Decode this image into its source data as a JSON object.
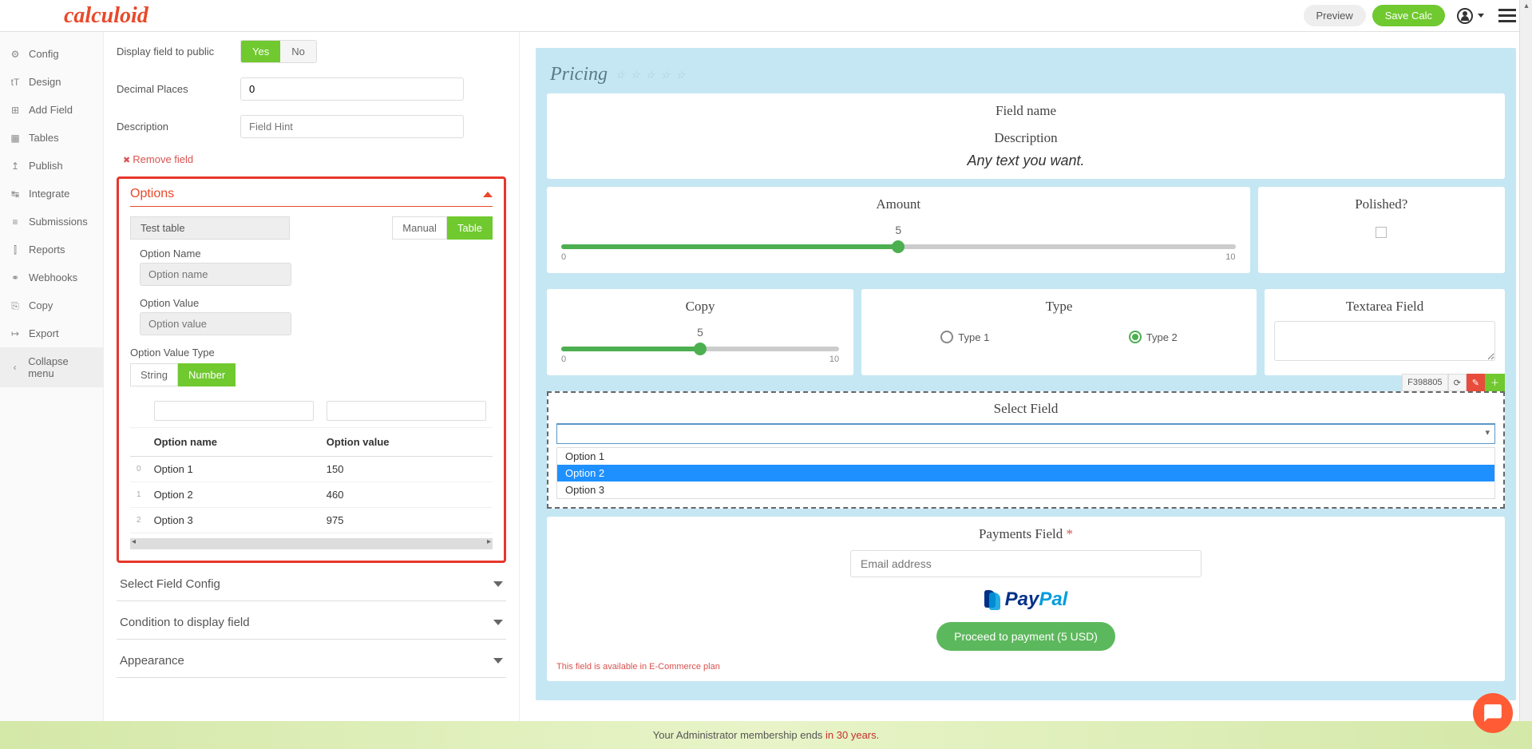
{
  "header": {
    "logo": "calculoid",
    "preview": "Preview",
    "save": "Save Calc"
  },
  "sidebar": {
    "items": [
      {
        "icon": "⚙",
        "label": "Config"
      },
      {
        "icon": "tT",
        "label": "Design"
      },
      {
        "icon": "⊞",
        "label": "Add Field"
      },
      {
        "icon": "▦",
        "label": "Tables"
      },
      {
        "icon": "↥",
        "label": "Publish"
      },
      {
        "icon": "↹",
        "label": "Integrate"
      },
      {
        "icon": "≡",
        "label": "Submissions"
      },
      {
        "icon": "⫿",
        "label": "Reports"
      },
      {
        "icon": "⚭",
        "label": "Webhooks"
      },
      {
        "icon": "⎘",
        "label": "Copy"
      },
      {
        "icon": "↦",
        "label": "Export"
      }
    ],
    "collapse": "Collapse menu"
  },
  "config": {
    "display_public_label": "Display field to public",
    "yes": "Yes",
    "no": "No",
    "decimal_label": "Decimal Places",
    "decimal_value": "0",
    "description_label": "Description",
    "description_placeholder": "Field Hint",
    "remove": "Remove field",
    "options_title": "Options",
    "table_name": "Test table",
    "manual": "Manual",
    "table": "Table",
    "option_name_label": "Option Name",
    "option_name_placeholder": "Option name",
    "option_value_label": "Option Value",
    "option_value_placeholder": "Option value",
    "value_type_label": "Option Value Type",
    "string": "String",
    "number": "Number",
    "col_name": "Option name",
    "col_value": "Option value",
    "rows": [
      {
        "idx": "0",
        "name": "Option 1",
        "value": "150"
      },
      {
        "idx": "1",
        "name": "Option 2",
        "value": "460"
      },
      {
        "idx": "2",
        "name": "Option 3",
        "value": "975"
      }
    ],
    "sections": [
      "Select Field Config",
      "Condition to display field",
      "Appearance"
    ]
  },
  "preview": {
    "title": "Pricing",
    "field_name": "Field name",
    "desc_label": "Description",
    "desc_text": "Any text you want.",
    "amount": {
      "title": "Amount",
      "value": "5",
      "min": "0",
      "max": "10"
    },
    "polished": {
      "title": "Polished?"
    },
    "copy": {
      "title": "Copy",
      "value": "5",
      "min": "0",
      "max": "10"
    },
    "type": {
      "title": "Type",
      "opt1": "Type 1",
      "opt2": "Type 2"
    },
    "textarea": {
      "title": "Textarea Field"
    },
    "toolbar": {
      "id": "F398805"
    },
    "select": {
      "title": "Select Field",
      "options": [
        "Option 1",
        "Option 2",
        "Option 3"
      ]
    },
    "payments": {
      "title": "Payments Field",
      "email_placeholder": "Email address",
      "paypal1": "Pay",
      "paypal2": "Pal",
      "button": "Proceed to payment (5 USD)",
      "note": "This field is available in E-Commerce plan"
    }
  },
  "footer": {
    "pre": "Your Administrator membership ends ",
    "highlight": "in 30 years."
  }
}
